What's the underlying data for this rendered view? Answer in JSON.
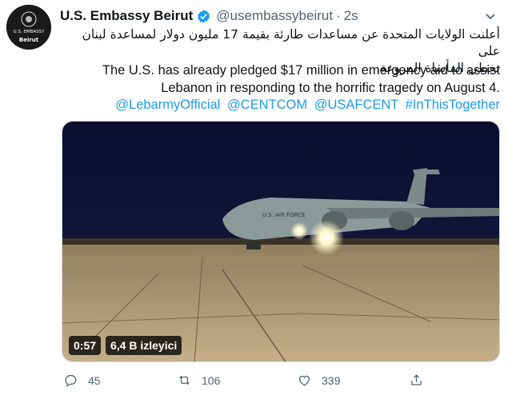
{
  "tweet": {
    "author_name": "U.S. Embassy Beirut",
    "handle": "@usembassybeirut",
    "separator": "·",
    "time": "2s",
    "avatar": {
      "seal_text": "U.S. EMBASSY",
      "label": "Beirut"
    },
    "arabic_line1": "أعلنت الولايات المتحدة عن مساعدات طارئة بقيمة 17 مليون دولار لمساعدة لبنان على",
    "arabic_line2": "تخطي المأساة المروعة.",
    "english_line1": "The U.S. has already pledged $17 million in emergency aid to assist",
    "english_line2": "Lebanon in responding to the horrific tragedy on August 4.",
    "mentions": [
      "@LebarmyOfficial",
      "@CENTCOM",
      "@USAFCENT",
      "#InThisTogether"
    ]
  },
  "video": {
    "duration": "0:57",
    "views": "6,4 B izleyici",
    "aircraft_marking": "U.S. AIR FORCE"
  },
  "actions": {
    "replies": "45",
    "retweets": "106",
    "likes": "339"
  },
  "colors": {
    "link": "#1d9bf0",
    "verified": "#1d9bf0",
    "muted": "#536471"
  }
}
